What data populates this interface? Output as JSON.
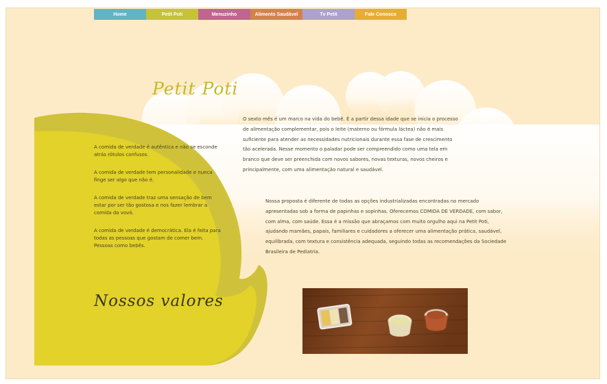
{
  "nav": [
    {
      "label": "Home",
      "color": "#62b4c2"
    },
    {
      "label": "Petit Poti",
      "color": "#c6c23a"
    },
    {
      "label": "Menuzinho",
      "color": "#c0668e"
    },
    {
      "label": "Alimento Saudável",
      "color": "#d3824e"
    },
    {
      "label": "Tv Petit",
      "color": "#ada2cc"
    },
    {
      "label": "Fale Conosco",
      "color": "#e5ad33"
    }
  ],
  "brand": {
    "logo_text": "Petit Poti"
  },
  "valores": {
    "items": [
      {
        "highlight": "A comida de verdade é autêntica",
        "rest": " e não se esconde atrás rótulos confusos."
      },
      {
        "highlight": "A comida de verdade tem personalidade",
        "rest": " e nunca finge ser algo que não é."
      },
      {
        "highlight": "A comida de verdade traz uma sensação de bem estar",
        "rest": " por ser tão gostosa e nos fazer lembrar a comida da vovó."
      },
      {
        "highlight": "A comida de verdade é democrática.",
        "rest": " Ela é feita para todas as pessoas que gostam de comer bem. Pessoas como bebês."
      }
    ],
    "title": "Nossos valores"
  },
  "intro": {
    "paragraph1": "O sexto mês é um marco na vida do bebê. É a partir dessa idade que se inicia o processo de alimentação complementar, pois o leite (materno ou fórmula láctea) não é mais suficiente para atender as necessidades nutricionais durante essa fase de crescimento tão acelerada. Nesse momento o paladar pode ser compreendido como uma tela em branco que deve ser preenchida com novos sabores, novas texturas, novos cheiros e principalmente, com uma alimentação natural e saudável.",
    "paragraph2": "Nossa proposta é diferente de todas as opções industrializadas encontradas no mercado apresentadas sob a forma de papinhas e sopinhas. Oferecemos COMIDA DE VERDADE, com sabor, com alma, com saúde. Essa é a missão que abraçamos com muito orgulho aqui na Petit Poti, ajudando mamães, papais, familiares e cuidadores a oferecer uma alimentação prática, saudável, equilibrada, com textura e consistência adequada, seguindo todas as recomendações da Sociedade Brasileira de Pediatria."
  },
  "colors": {
    "page_bg": "#fdebc8",
    "blob_dark": "#cfc23a",
    "blob_light": "#e2d22a",
    "brand": "#c6b829"
  }
}
